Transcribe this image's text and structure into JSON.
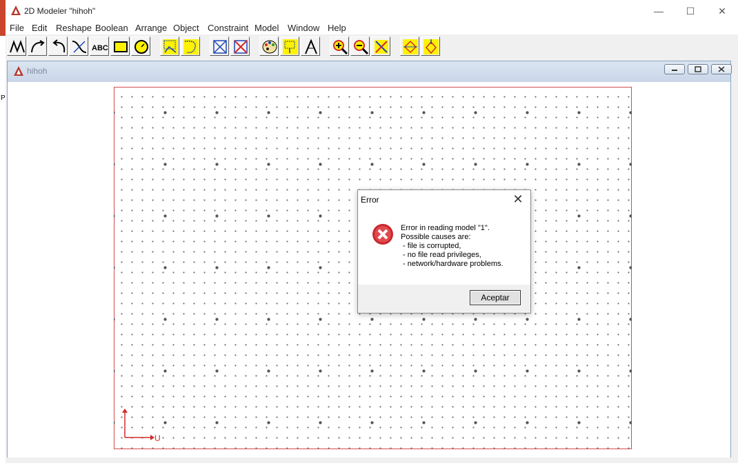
{
  "app": {
    "title": "2D Modeler \"hihoh\"",
    "side_letter": "P"
  },
  "window_controls": {
    "minimize": "—",
    "maximize": "☐",
    "close": "✕"
  },
  "menu": [
    "File",
    "Edit",
    "Reshape",
    "Boolean",
    "Arrange",
    "Object",
    "Constraint",
    "Model",
    "Window",
    "Help"
  ],
  "toolbar": {
    "buttons": [
      "polyline-tool",
      "arc-tool",
      "undo-curve-tool",
      "bezier-tool",
      "text-tool",
      "rectangle-tool",
      "circle-tool",
      "select-tool",
      "freeform-select-tool",
      "intersect-tool",
      "subtract-tool",
      "color-tool",
      "pattern-tool",
      "trim-tool",
      "zoom-in-tool",
      "zoom-out-tool",
      "zoom-fit-tool",
      "dimension-tool",
      "constraint-tool"
    ],
    "text_button_label": "ABC"
  },
  "child_window": {
    "title": "hihoh"
  },
  "canvas": {
    "axis_label_u": "U",
    "border_color": "#d24a4a"
  },
  "dialog": {
    "title": "Error",
    "close_label": "✕",
    "message_lines": [
      "Error in reading model \"1\".",
      "Possible causes are:",
      " - file is corrupted,",
      " - no file read privileges,",
      " - network/hardware problems."
    ],
    "ok_label": "Aceptar",
    "icon": "error-icon"
  }
}
